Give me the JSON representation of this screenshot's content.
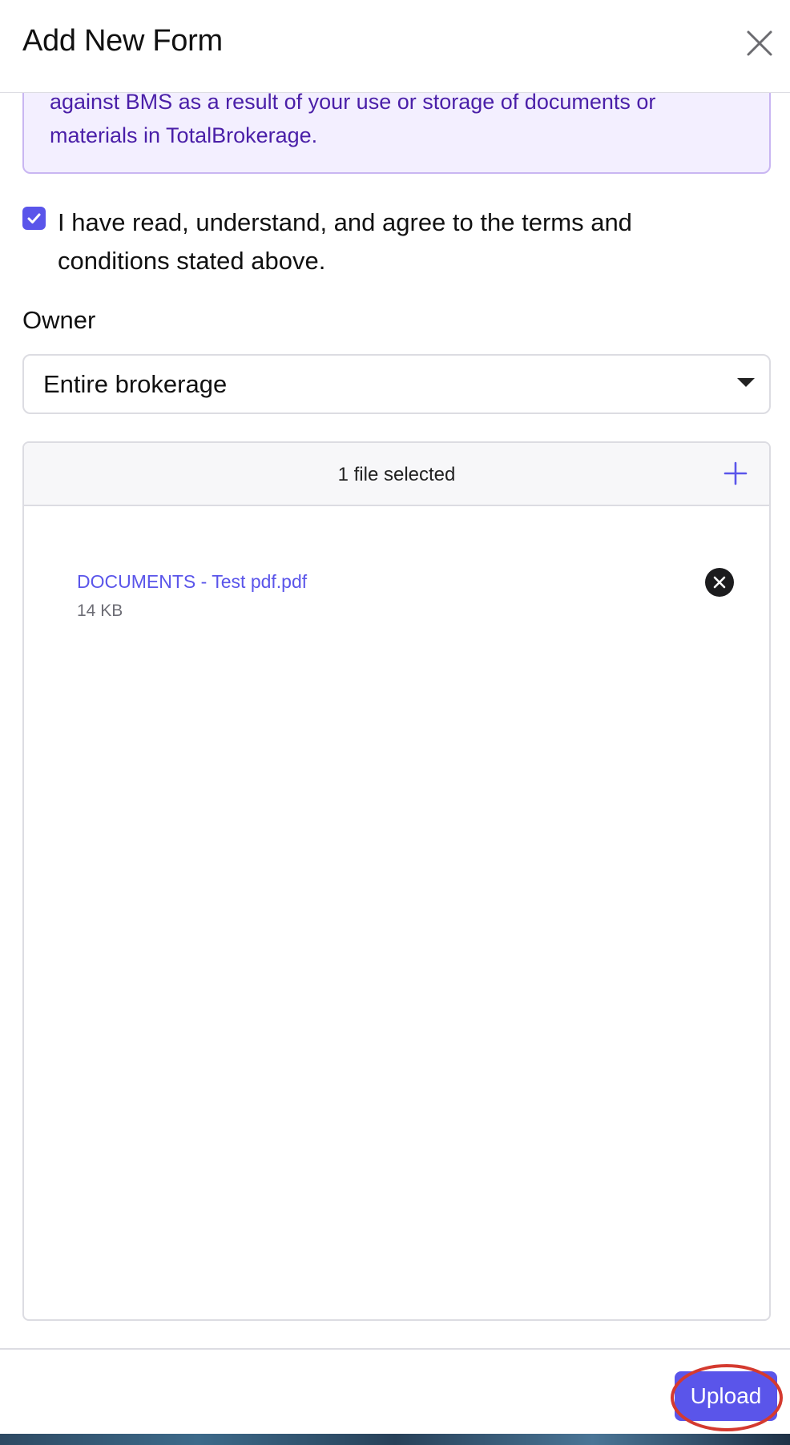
{
  "dialog": {
    "title": "Add New Form",
    "close_icon": "close-icon"
  },
  "notice": {
    "line1": "against BMS as a result of your use or storage of documents or",
    "line2": "materials in TotalBrokerage."
  },
  "agreement": {
    "checked": true,
    "label": "I have read, understand, and agree to the terms and conditions stated above."
  },
  "owner": {
    "label": "Owner",
    "selected": "Entire brokerage"
  },
  "files": {
    "summary": "1 file selected",
    "add_icon": "plus-icon",
    "items": [
      {
        "name": "DOCUMENTS - Test pdf.pdf",
        "size": "14 KB"
      }
    ]
  },
  "footer": {
    "upload_label": "Upload"
  },
  "colors": {
    "accent": "#5a55ea",
    "notice_bg": "#f3efff",
    "notice_text": "#4a1fa8",
    "highlight": "#d43a2f"
  }
}
